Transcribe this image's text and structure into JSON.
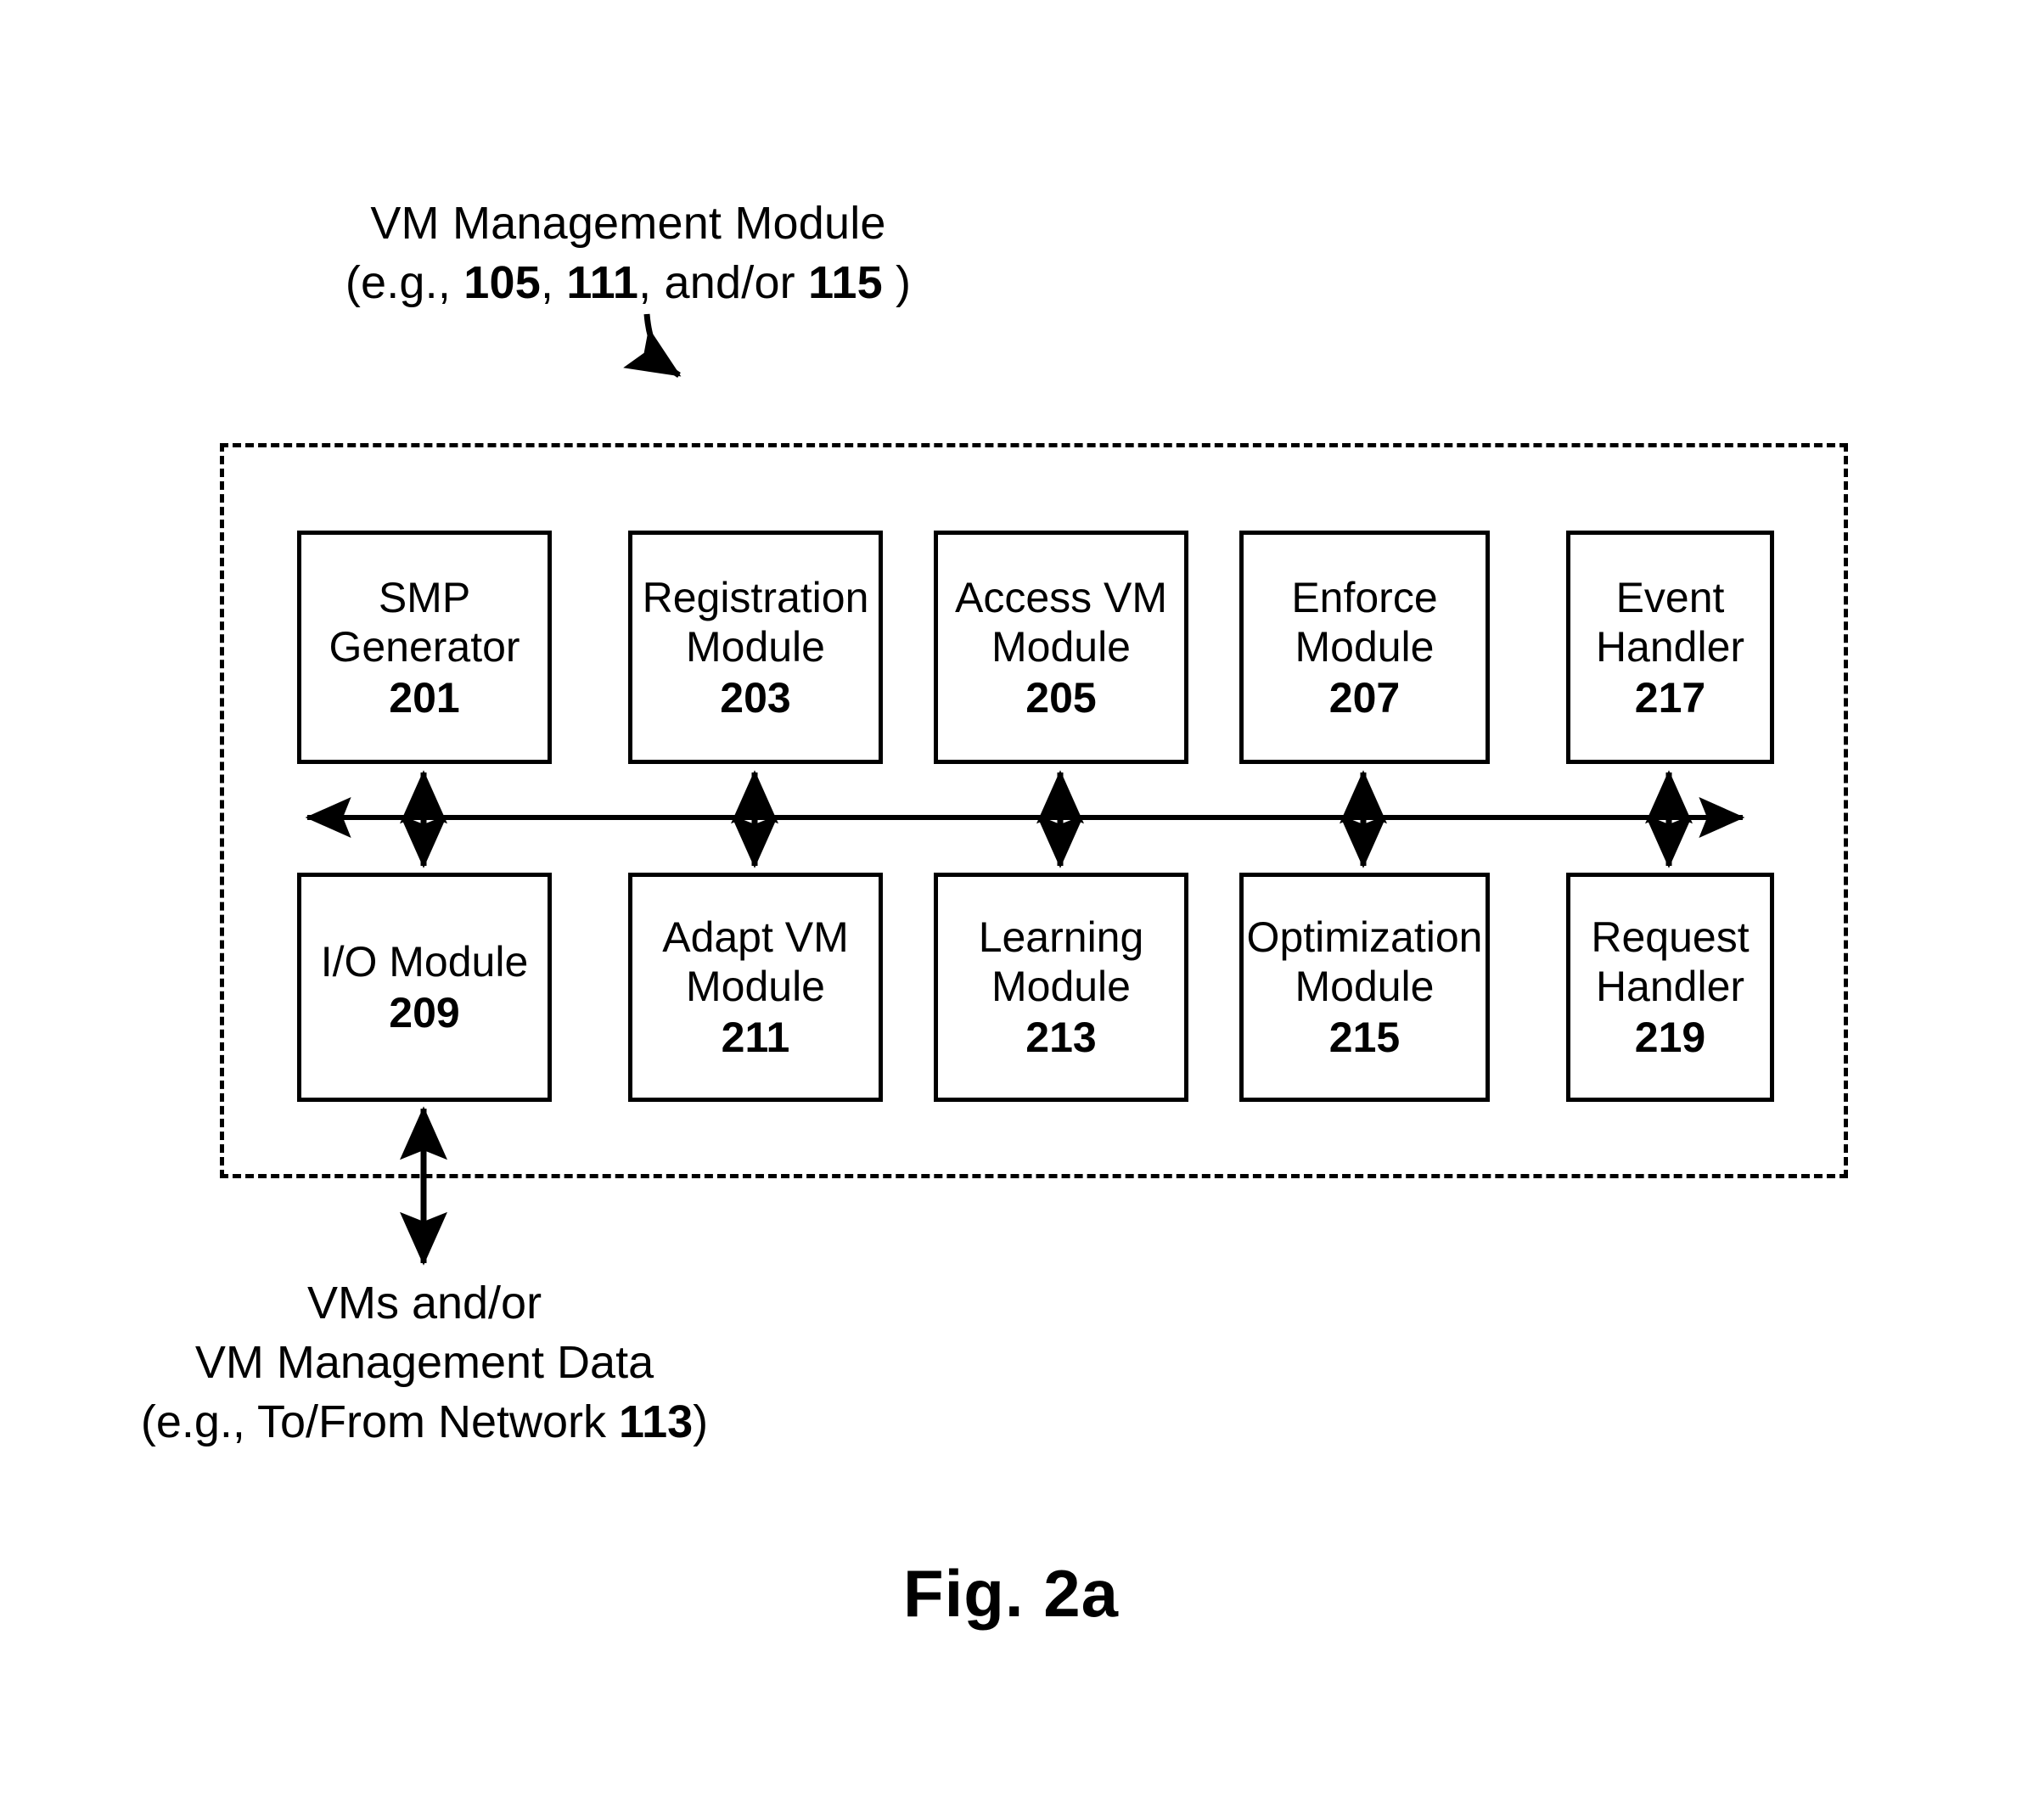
{
  "callout": {
    "line1": "VM Management Module",
    "line2_prefix": "(e.g., ",
    "ref_a": "105",
    "sep_a": ", ",
    "ref_b": "111",
    "sep_b": ", and/or ",
    "ref_c": "115",
    "line2_suffix": " )"
  },
  "diagram": {
    "top_row": [
      {
        "label": "SMP\nGenerator",
        "number": "201"
      },
      {
        "label": "Registration\nModule",
        "number": "203"
      },
      {
        "label": "Access VM\nModule",
        "number": "205"
      },
      {
        "label": "Enforce\nModule",
        "number": "207"
      },
      {
        "label": "Event\nHandler",
        "number": "217"
      }
    ],
    "bottom_row": [
      {
        "label": "I/O Module",
        "number": "209"
      },
      {
        "label": "Adapt VM\nModule",
        "number": "211"
      },
      {
        "label": "Learning\nModule",
        "number": "213"
      },
      {
        "label": "Optimization\nModule",
        "number": "215"
      },
      {
        "label": "Request\nHandler",
        "number": "219"
      }
    ]
  },
  "io_caption": {
    "line1": "VMs and/or",
    "line2": "VM Management Data",
    "line3_prefix": "(e.g., To/From Network ",
    "line3_ref": "113",
    "line3_suffix": ")"
  },
  "figure_label": "Fig. 2a",
  "colors": {
    "ink": "#000000",
    "paper": "#ffffff"
  }
}
